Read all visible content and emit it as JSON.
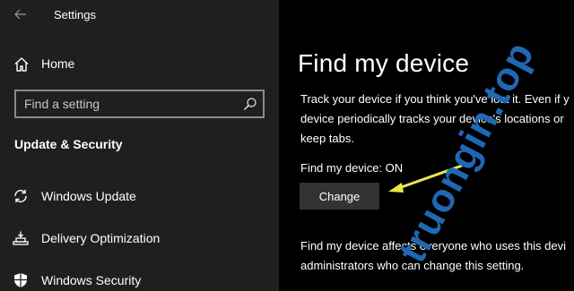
{
  "window": {
    "title": "Settings"
  },
  "sidebar": {
    "home_label": "Home",
    "search": {
      "placeholder": "Find a setting"
    },
    "section_title": "Update & Security",
    "items": [
      {
        "label": "Windows Update",
        "icon": "sync-icon"
      },
      {
        "label": "Delivery Optimization",
        "icon": "delivery-optimization-icon"
      },
      {
        "label": "Windows Security",
        "icon": "shield-icon"
      }
    ]
  },
  "content": {
    "title": "Find my device",
    "description_lines": [
      "Track your device if you think you've lost it. Even if y",
      "device periodically tracks your device's locations or",
      "keep tabs."
    ],
    "status_label": "Find my device:",
    "status_value": "ON",
    "change_label": "Change",
    "note_lines": [
      "Find my device affects everyone who uses this devi",
      "administrators who can change this setting."
    ]
  },
  "overlay": {
    "watermark_text": "truongin.top",
    "watermark_color": "#1f68b4",
    "arrow_color": "#e8e84a"
  },
  "colors": {
    "sidebar_bg": "#1f1f1f",
    "content_bg": "#000000",
    "button_bg": "#333333"
  }
}
